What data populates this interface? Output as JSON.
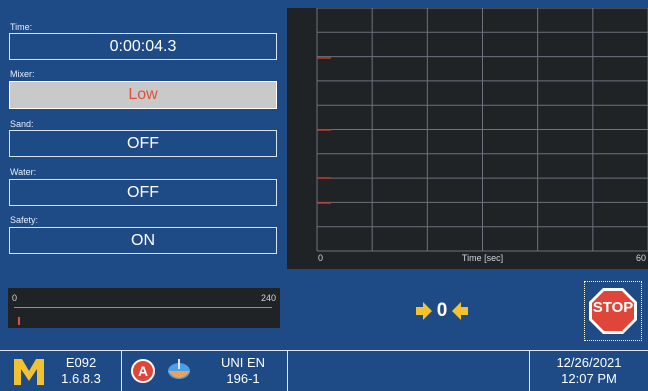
{
  "fields": {
    "time": {
      "label": "Time:",
      "value": "0:00:04.3"
    },
    "mixer": {
      "label": "Mixer:",
      "value": "Low"
    },
    "sand": {
      "label": "Sand:",
      "value": "OFF"
    },
    "water": {
      "label": "Water:",
      "value": "OFF"
    },
    "safety": {
      "label": "Safety:",
      "value": "ON"
    }
  },
  "chart_data": {
    "type": "line",
    "xlabel": "Time [sec]",
    "x_ticks": [
      "0",
      "60"
    ],
    "xlim": [
      0,
      60
    ],
    "grid": true,
    "series": []
  },
  "mini_gauge": {
    "min_label": "0",
    "max_label": "240",
    "value": 4
  },
  "side_icons": [
    "mixer-icon",
    "sand-pile-icon",
    "water-drop-icon",
    "safety-bell-icon"
  ],
  "center_indicator": {
    "value": "0"
  },
  "stop_button": {
    "label": "STOP"
  },
  "bottom": {
    "code": "E092",
    "version": "1.6.8.3",
    "badge": "A",
    "standard_line1": "UNI EN",
    "standard_line2": "196-1",
    "date": "12/26/2021",
    "time": "12:07 PM"
  },
  "colors": {
    "panel": "#1e4a86",
    "plot_bg": "#1f2326",
    "accent_red": "#e0503a",
    "logo_yellow": "#f2c230"
  }
}
